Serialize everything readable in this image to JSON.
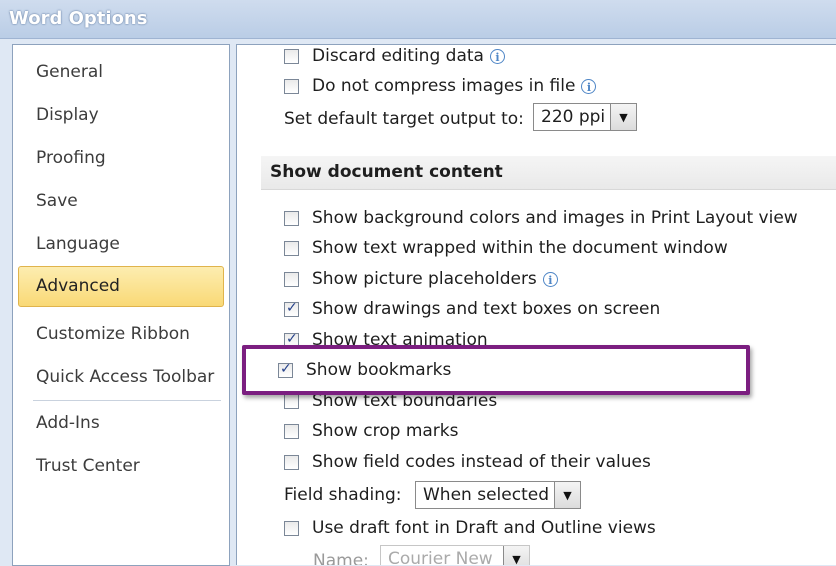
{
  "window": {
    "title": "Word Options"
  },
  "sidebar": {
    "items": [
      {
        "label": "General"
      },
      {
        "label": "Display"
      },
      {
        "label": "Proofing"
      },
      {
        "label": "Save"
      },
      {
        "label": "Language"
      },
      {
        "label": "Advanced",
        "selected": true
      },
      {
        "label": "Customize Ribbon"
      },
      {
        "label": "Quick Access Toolbar"
      },
      {
        "label": "Add-Ins"
      },
      {
        "label": "Trust Center"
      }
    ]
  },
  "image_options": {
    "discard_editing_data": {
      "label": "Discard editing data",
      "checked": false
    },
    "do_not_compress": {
      "label": "Do not compress images in file",
      "checked": false
    },
    "target_output": {
      "label": "Set default target output to:",
      "value": "220 ppi"
    }
  },
  "show_document_content": {
    "header": "Show document content",
    "options": [
      {
        "label": "Show background colors and images in Print Layout view",
        "checked": false
      },
      {
        "label": "Show text wrapped within the document window",
        "checked": false
      },
      {
        "label": "Show picture placeholders",
        "checked": false,
        "info": true
      },
      {
        "label": "Show drawings and text boxes on screen",
        "checked": true
      },
      {
        "label": "Show text animation",
        "checked": true
      },
      {
        "label": "Show bookmarks",
        "checked": true,
        "highlighted": true
      },
      {
        "label": "Show text boundaries",
        "checked": false
      },
      {
        "label": "Show crop marks",
        "checked": false
      },
      {
        "label": "Show field codes instead of their values",
        "checked": false
      }
    ],
    "field_shading": {
      "label": "Field shading:",
      "value": "When selected"
    },
    "draft_font": {
      "label": "Use draft font in Draft and Outline views",
      "checked": false
    },
    "name_partial": {
      "label": "Name:",
      "value": "Courier New"
    }
  },
  "colors": {
    "highlight_border": "#7b1e80",
    "selected_nav": "#f9d976"
  }
}
